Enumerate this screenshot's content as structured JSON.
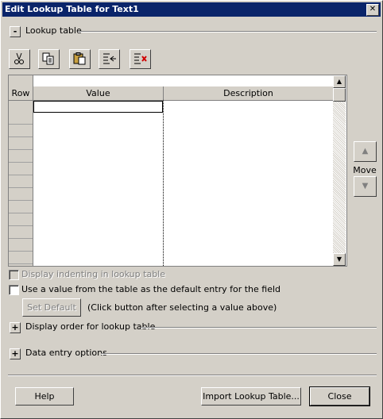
{
  "window": {
    "title": "Edit Lookup Table for Text1",
    "close_glyph": "✕"
  },
  "lookup_section": {
    "toggle": "-",
    "label": "Lookup table"
  },
  "toolbar": [
    {
      "name": "cut-icon"
    },
    {
      "name": "copy-icon"
    },
    {
      "name": "paste-icon"
    },
    {
      "name": "insert-row-icon"
    },
    {
      "name": "delete-row-icon"
    }
  ],
  "table": {
    "headers": {
      "row": "Row",
      "value": "Value",
      "description": "Description"
    },
    "rows": []
  },
  "move": {
    "label": "Move",
    "up_glyph": "▲",
    "down_glyph": "▼"
  },
  "options": {
    "display_indenting": {
      "label": "Display indenting in lookup table",
      "checked": false,
      "enabled": false
    },
    "use_default": {
      "label": "Use a value from the table as the default entry for the field",
      "checked": false,
      "enabled": true
    },
    "set_default_button": "Set Default",
    "set_default_hint": "(Click button after selecting a value above)"
  },
  "display_order_section": {
    "toggle": "+",
    "label": "Display order for lookup table"
  },
  "data_entry_section": {
    "toggle": "+",
    "label": "Data entry options"
  },
  "footer": {
    "help": "Help",
    "import": "Import Lookup Table...",
    "close": "Close"
  }
}
